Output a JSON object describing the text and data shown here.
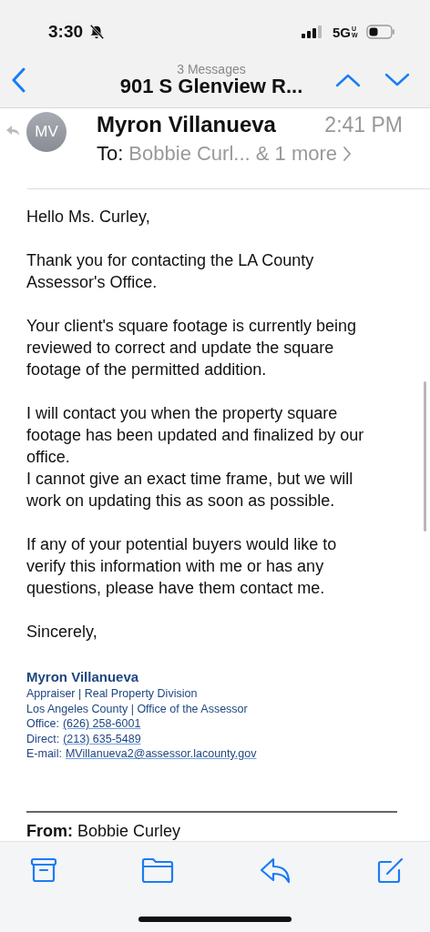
{
  "status_bar": {
    "time": "3:30",
    "network": "5G",
    "network_badge": "UW"
  },
  "nav": {
    "subtitle": "3 Messages",
    "title": "901 S Glenview R..."
  },
  "message": {
    "avatar_initials": "MV",
    "sender": "Myron Villanueva",
    "time": "2:41 PM",
    "to_label": "To:",
    "recipients": "Bobbie Curl... & 1 more"
  },
  "body": {
    "paragraphs": [
      "Hello Ms. Curley,",
      "Thank you for contacting the LA County Assessor's Office.",
      "Your client's square footage is currently being reviewed to correct and update the square footage of the permitted addition.",
      "I will contact you when the property square footage has been updated and finalized by our office.\nI cannot give an exact time frame, but we will work on updating this as soon as possible.",
      "If any of your potential buyers would like to verify this information with me or has any questions, please have them contact me.",
      "Sincerely,"
    ]
  },
  "signature": {
    "name": "Myron Villanueva",
    "lines": [
      {
        "text": "Appraiser | Real Property Division"
      },
      {
        "text": "Los Angeles County | Office of the Assessor"
      },
      {
        "text": "Office:",
        "link": "(626) 258-6001"
      },
      {
        "text": "Direct:",
        "link": "(213) 635-5489"
      },
      {
        "text": "E-mail:",
        "link": "MVillanueva2@assessor.lacounty.gov"
      }
    ]
  },
  "quoted": {
    "label": "From:",
    "value": "Bobbie Curley"
  },
  "toolbar": [
    {
      "kind": "archive"
    },
    {
      "kind": "folder"
    },
    {
      "kind": "reply"
    },
    {
      "kind": "compose"
    }
  ]
}
